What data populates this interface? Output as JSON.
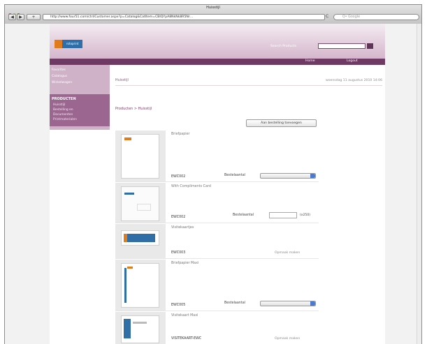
{
  "browser": {
    "window_title": "Huisstijl",
    "url": "http://www.four51.com/ctrl/Customer.aspx?p=Catalog&CatItem=CBIQYpA8NkNk8R5Nr…",
    "search_placeholder": "Q• Google",
    "back_glyph": "◀",
    "forward_glyph": "▶",
    "reload_glyph": "C"
  },
  "header": {
    "logo_text": "rotoprint",
    "search_label": "Search Products",
    "nav": [
      "Home",
      "Logout"
    ]
  },
  "sidebar": {
    "items": [
      "Favorites",
      "Catalogus",
      "Winkelwagen"
    ],
    "section_heading": "PRODUCTEN",
    "sub_items": [
      "Huisstijl",
      "Bestelling en",
      "Documenten",
      "Printmaterialen"
    ]
  },
  "main": {
    "page_name": "Huisstijl",
    "date": "woensdag 11 augustus 2010 14:06",
    "breadcrumb": "Producten > Huisstijl",
    "order_button": "Aan bestelling toevoegen",
    "products": [
      {
        "name": "Briefpapier",
        "code": "EWC002",
        "qty_label": "Bestelaantal",
        "control": "select"
      },
      {
        "name": "With Compliments Card",
        "code": "EWC002",
        "qty_label": "Bestelaantal",
        "control": "input",
        "unit": "(x250)"
      },
      {
        "name": "Visitekaartjes",
        "code": "EWC003",
        "control": "link",
        "link": "Opmaak maken"
      },
      {
        "name": "Briefpapier Maxi",
        "code": "EWC005",
        "qty_label": "Bestelaantal",
        "control": "select"
      },
      {
        "name": "Visitekaart Maxi",
        "code": "VISITEKAART-EWC",
        "control": "link",
        "link": "Opmaak maken"
      }
    ]
  },
  "colors": {
    "brand_purple": "#6e3a63",
    "accent_orange": "#e27b1c",
    "logo_blue": "#2f6ea7"
  }
}
